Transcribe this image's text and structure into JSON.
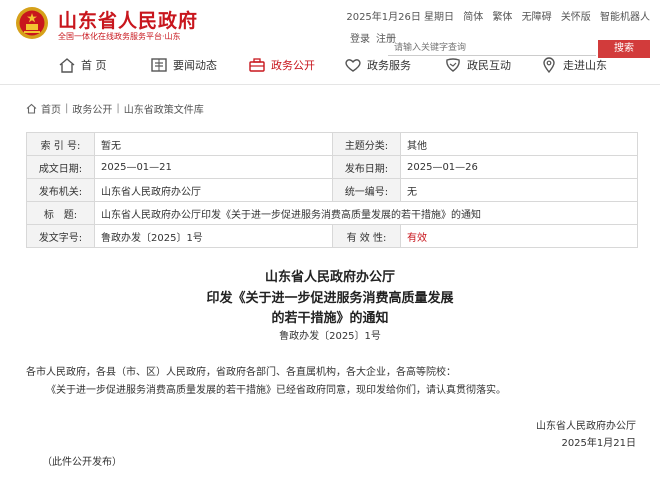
{
  "header": {
    "site_title": "山东省人民政府",
    "site_subtitle": "全国一体化在线政务服务平台·山东",
    "date": "2025年1月26日 星期日",
    "links": [
      "简体",
      "繁体",
      "无障碍",
      "关怀版",
      "智能机器人"
    ],
    "login": "登录",
    "register": "注册",
    "search_placeholder": "请输入关键字查询",
    "search_button": "搜索"
  },
  "nav": {
    "items": [
      {
        "label": "首 页",
        "icon": "home-icon"
      },
      {
        "label": "要闻动态",
        "icon": "news-icon"
      },
      {
        "label": "政务公开",
        "icon": "briefcase-icon",
        "active": true
      },
      {
        "label": "政务服务",
        "icon": "heart-icon"
      },
      {
        "label": "政民互动",
        "icon": "handshake-icon"
      },
      {
        "label": "走进山东",
        "icon": "location-pin-icon"
      }
    ]
  },
  "breadcrumb": [
    "首页",
    "政务公开",
    "山东省政策文件库"
  ],
  "info": {
    "index_label": "索 引 号:",
    "index_value": "暂无",
    "topic_label": "主题分类:",
    "topic_value": "其他",
    "created_label": "成文日期:",
    "created_value": "2025—01—21",
    "published_label": "发布日期:",
    "published_value": "2025—01—26",
    "issuer_label": "发布机关:",
    "issuer_value": "山东省人民政府办公厅",
    "serial_label": "统一编号:",
    "serial_value": "无",
    "title_label": "标　题:",
    "title_value": "山东省人民政府办公厅印发《关于进一步促进服务消费高质量发展的若干措施》的通知",
    "docno_label": "发文字号:",
    "docno_value": "鲁政办发〔2025〕1号",
    "validity_label": "有 效 性:",
    "validity_value": "有效"
  },
  "document": {
    "title_line1": "山东省人民政府办公厅",
    "title_line2": "印发《关于进一步促进服务消费高质量发展",
    "title_line3": "的若干措施》的通知",
    "doc_number": "鲁政办发〔2025〕1号",
    "recipients": "各市人民政府，各县（市、区）人民政府，省政府各部门、各直属机构，各大企业，各高等院校：",
    "body": "《关于进一步促进服务消费高质量发展的若干措施》已经省政府同意，现印发给你们，请认真贯彻落实。",
    "signature": "山东省人民政府办公厅",
    "sign_date": "2025年1月21日",
    "note": "（此件公开发布）"
  },
  "colors": {
    "brand_red": "#c8161d",
    "search_button": "#d23b3b"
  }
}
